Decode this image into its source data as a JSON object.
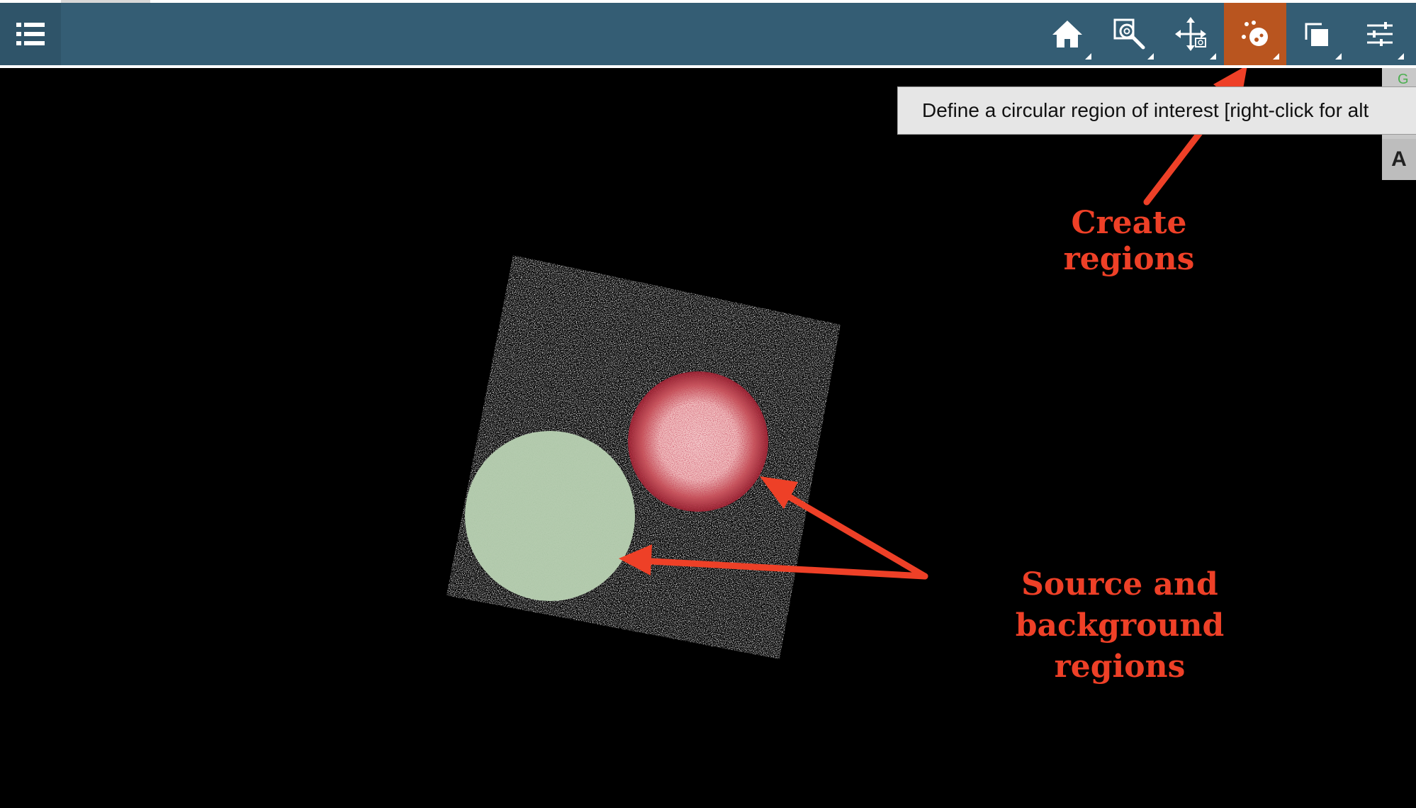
{
  "toolbar": {
    "menu_icon": "list-icon",
    "tools": [
      {
        "name": "home",
        "icon": "home-icon",
        "active": false
      },
      {
        "name": "zoom",
        "icon": "zoom-region-icon",
        "active": false
      },
      {
        "name": "pan",
        "icon": "pan-icon",
        "active": false
      },
      {
        "name": "regions",
        "icon": "circle-region-icon",
        "active": true
      },
      {
        "name": "frames",
        "icon": "frames-icon",
        "active": false
      },
      {
        "name": "settings",
        "icon": "sliders-icon",
        "active": false
      }
    ],
    "active_color": "#b9551f",
    "bar_color": "#345d74"
  },
  "tooltip": {
    "text": "Define a circular region of interest [right-click for alt"
  },
  "side_panel": {
    "letter": "A",
    "green_glyph": "G"
  },
  "annotations": {
    "create_regions": "Create regions",
    "source_background_line1": "Source and background",
    "source_background_line2": "regions"
  },
  "colors": {
    "annotation": "#ee4027",
    "source_region": "#f2c6c6",
    "background_region": "#b4cbae"
  }
}
